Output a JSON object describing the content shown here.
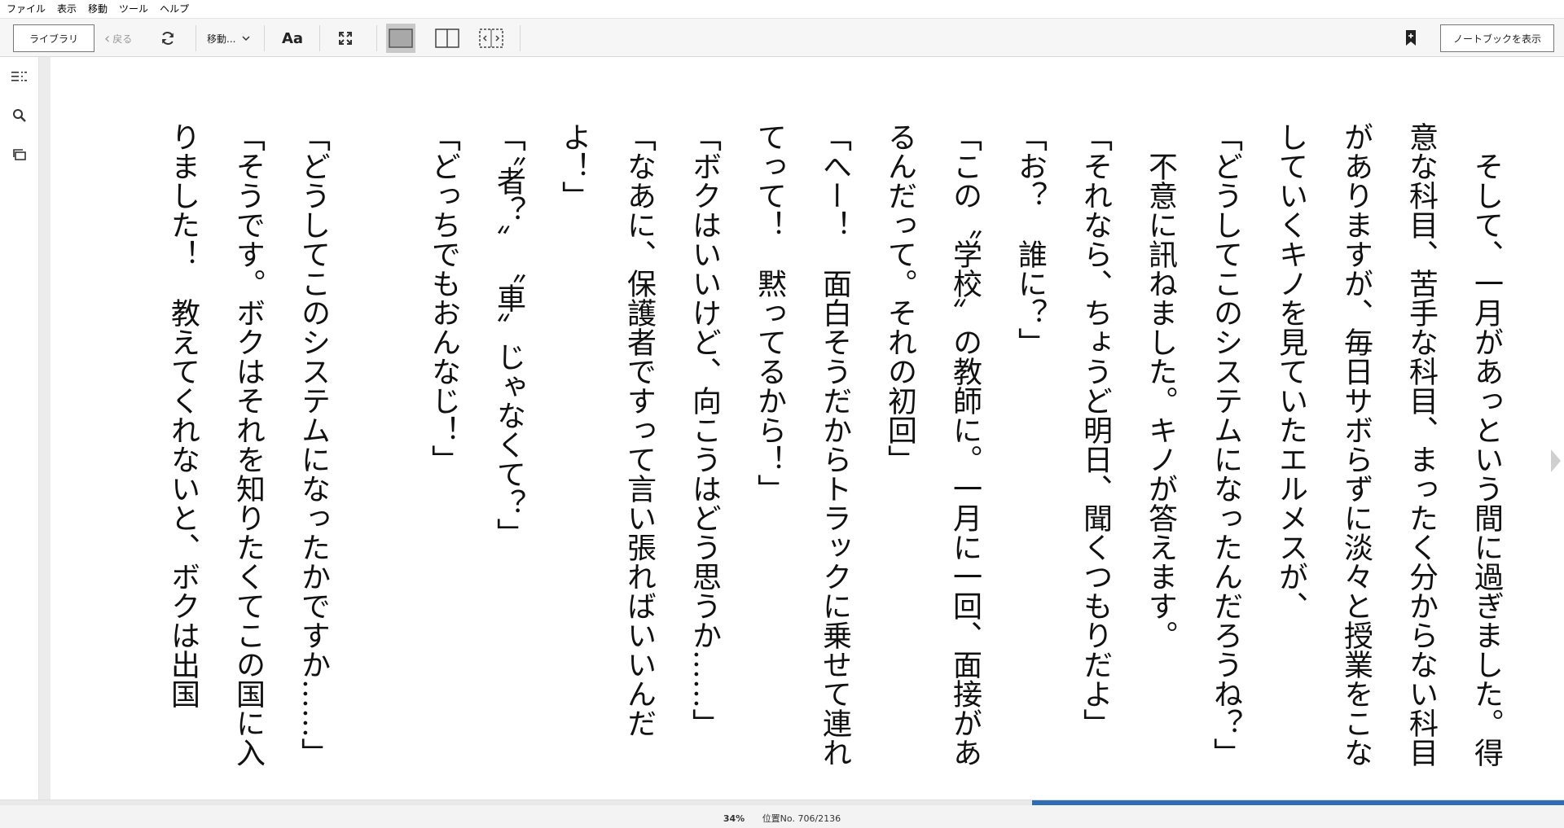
{
  "menu": [
    "ファイル",
    "表示",
    "移動",
    "ツール",
    "ヘルプ"
  ],
  "toolbar": {
    "library_label": "ライブラリ",
    "back_label": "戻る",
    "goto_label": "移動...",
    "font_label": "Aa",
    "notebook_label": "ノートブックを表示"
  },
  "content": {
    "paragraphs": [
      "　そして、一月があっという間に過ぎました。得意な科目、苦手な科目、まったく分からない科目がありますが、毎日サボらずに淡々と授業をこなしていくキノを見ていたエルメスが、",
      "「どうしてこのシステムになったんだろうね？」",
      "　不意に訊ねました。キノが答えます。",
      "「それなら、ちょうど明日、聞くつもりだよ」",
      "「お？　誰に？」",
      "「この〝学校〟の教師に。一月に一回、面接があるんだって。それの初回」",
      "「へー！　面白そうだからトラックに乗せて連れてって！　黙ってるから！」",
      "「ボクはいいけど、向こうはどう思うか……」",
      "「なあに、保護者ですって言い張ればいいんだよ！」",
      "「〝者？〟　〝車〟じゃなくて？」",
      "「どっちでもおんなじ！」",
      "",
      "「どうしてこのシステムになったかですか……」",
      "「そうです。ボクはそれを知りたくてこの国に入りました！　教えてくれないと、ボクは出国"
    ]
  },
  "footer": {
    "percent": "34%",
    "location": "位置No. 706/2136",
    "progress": 0.34
  }
}
